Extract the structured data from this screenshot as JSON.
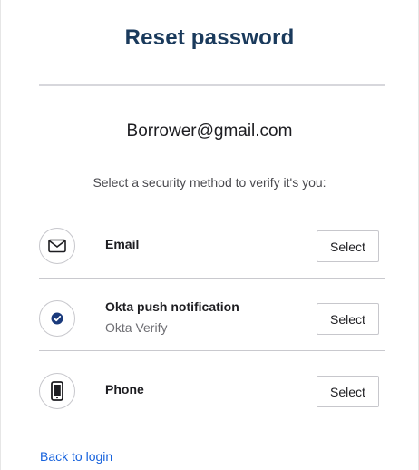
{
  "page": {
    "title": "Reset password",
    "identifier": "Borrower@gmail.com",
    "subtitle": "Select a security method to verify it's you:"
  },
  "methods": [
    {
      "title": "Email",
      "subtitle": "",
      "icon": "envelope-icon",
      "button": "Select"
    },
    {
      "title": "Okta push notification",
      "subtitle": "Okta Verify",
      "icon": "okta-verify-icon",
      "button": "Select"
    },
    {
      "title": "Phone",
      "subtitle": "",
      "icon": "phone-icon",
      "button": "Select"
    }
  ],
  "footer": {
    "back_link": "Back to login"
  },
  "colors": {
    "title": "#1a3a5c",
    "link": "#1662dd",
    "okta_icon": "#1a3a7c",
    "border": "#c7c7cc"
  }
}
